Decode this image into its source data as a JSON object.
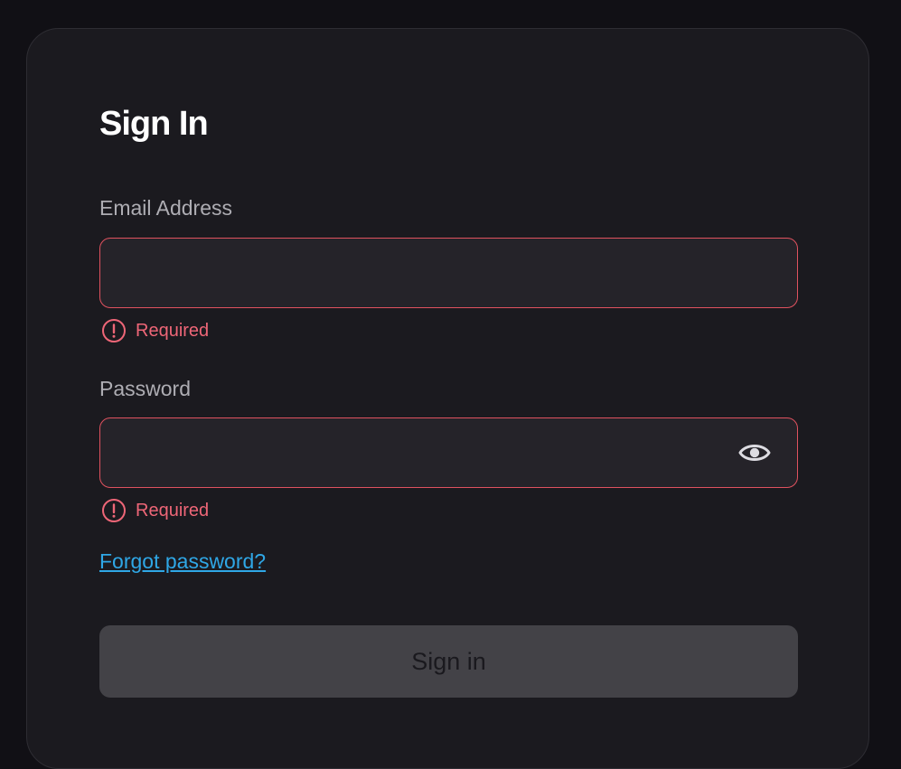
{
  "form": {
    "title": "Sign In",
    "email": {
      "label": "Email Address",
      "value": "",
      "placeholder": "",
      "error": "Required"
    },
    "password": {
      "label": "Password",
      "value": "",
      "placeholder": "",
      "error": "Required",
      "toggle_icon": "eye-icon"
    },
    "forgot_link": "Forgot password?",
    "submit_label": "Sign in"
  },
  "colors": {
    "background": "#111015",
    "card": "#1b1a1f",
    "input_bg": "#252329",
    "error": "#ee6677",
    "link": "#2fa7e6",
    "button_disabled": "#434247"
  }
}
